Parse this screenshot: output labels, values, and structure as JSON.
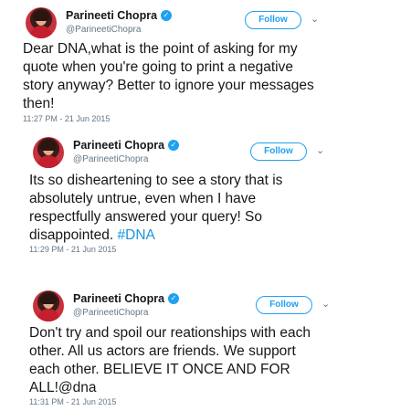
{
  "tweets": [
    {
      "name": "Parineeti Chopra",
      "handle": "@ParineetiChopra",
      "follow_label": "Follow",
      "text_lines": [
        "Dear DNA,what is the point of asking for my",
        "quote when you're going to print a negative",
        "story anyway? Better to ignore your messages",
        "then!"
      ],
      "timestamp": "11:27 PM - 21 Jun 2015"
    },
    {
      "name": "Parineeti Chopra",
      "handle": "@ParineetiChopra",
      "follow_label": "Follow",
      "text_lines": [
        "Its so disheartening to see a story that is",
        "absolutely untrue, even when I have",
        "respectfully answered your query! So",
        "disappointed."
      ],
      "hashtag": "#DNA",
      "timestamp": "11:29 PM - 21 Jun 2015"
    },
    {
      "name": "Parineeti Chopra",
      "handle": "@ParineetiChopra",
      "follow_label": "Follow",
      "text_lines": [
        "Don't try and spoil our reationships with each",
        "other. All us actors are friends. We support",
        "each other. BELIEVE IT ONCE AND FOR",
        "ALL!@dna"
      ],
      "timestamp": "11:31 PM - 21 Jun 2015"
    }
  ],
  "icons": {
    "verified": "verified-badge-icon",
    "more": "chevron-down-icon"
  },
  "colors": {
    "accent": "#1da1f2",
    "text": "#14171a",
    "muted": "#657786"
  }
}
